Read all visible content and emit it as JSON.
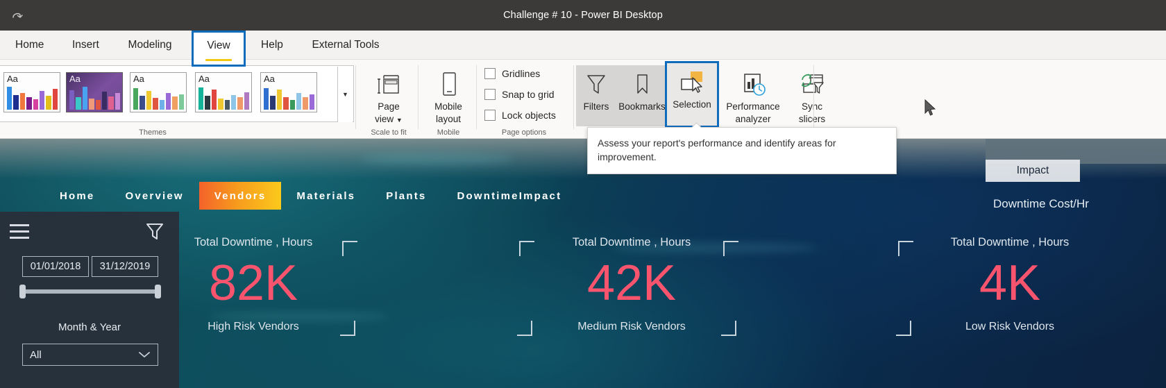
{
  "window": {
    "title": "Challenge # 10 - Power BI Desktop",
    "redo_icon": "redo-icon"
  },
  "ribbon": {
    "tabs": [
      {
        "label": "Home",
        "selected": false
      },
      {
        "label": "Insert",
        "selected": false
      },
      {
        "label": "Modeling",
        "selected": false
      },
      {
        "label": "View",
        "selected": true
      },
      {
        "label": "Help",
        "selected": false
      },
      {
        "label": "External Tools",
        "selected": false
      }
    ],
    "groups": {
      "themes": {
        "label": "Themes"
      },
      "scale_to_fit": {
        "label": "Scale to fit"
      },
      "mobile": {
        "label": "Mobile"
      },
      "page_options": {
        "label": "Page options"
      }
    },
    "themes": {
      "swatch_text": "Aa",
      "more_icon": "chevron-down-icon",
      "swatches": [
        {
          "name": "theme-swatch-0",
          "selected": false,
          "bars": [
            "#c084c0",
            "#8e5aa8"
          ]
        },
        {
          "name": "theme-swatch-1",
          "selected": false,
          "bars": [
            "#2f8de4",
            "#1d2f8f",
            "#f0783c",
            "#7b1e8c",
            "#d6409f",
            "#9a6bd6",
            "#e3c019",
            "#e0453f"
          ]
        },
        {
          "name": "theme-swatch-2",
          "selected": true,
          "bars": [
            "#7b5fc0",
            "#3ac9c9",
            "#4aa3f0",
            "#f09a7a",
            "#e0553f",
            "#3a2b63",
            "#e0608f",
            "#c88ad6"
          ]
        },
        {
          "name": "theme-swatch-3",
          "selected": false,
          "bars": [
            "#4aa85e",
            "#3c4d8c",
            "#f0c830",
            "#e0553f",
            "#6fb0e8",
            "#9a6bd6",
            "#f0a060",
            "#7ec99a"
          ]
        },
        {
          "name": "theme-swatch-4",
          "selected": false,
          "bars": [
            "#14b39a",
            "#2b3a42",
            "#e0453f",
            "#f0c830",
            "#4a5a62",
            "#8fc6e8",
            "#f09a6a",
            "#b07ac0"
          ]
        },
        {
          "name": "theme-swatch-5",
          "selected": false,
          "bars": [
            "#2f6fd0",
            "#2b3a72",
            "#f0c830",
            "#e0553f",
            "#3a9a5e",
            "#8fc6e8",
            "#f09a6a",
            "#9a6bd6"
          ]
        }
      ]
    },
    "buttons": {
      "page_view": {
        "label_line1": "Page",
        "label_line2": "view",
        "icon": "page-view-icon",
        "has_caret": true
      },
      "mobile_layout": {
        "label_line1": "Mobile",
        "label_line2": "layout",
        "icon": "mobile-layout-icon"
      },
      "filters": {
        "label": "Filters",
        "icon": "filter-funnel-icon",
        "highlighted": true
      },
      "bookmarks": {
        "label": "Bookmarks",
        "icon": "bookmark-icon",
        "highlighted": true
      },
      "selection": {
        "label": "Selection",
        "icon": "selection-pane-icon",
        "selected": true
      },
      "performance": {
        "label_line1": "Performance",
        "label_line2": "analyzer",
        "icon": "performance-analyzer-icon"
      },
      "sync_slicers": {
        "label_line1": "Sync",
        "label_line2": "slicers",
        "icon": "sync-slicers-icon"
      }
    },
    "checkboxes": [
      {
        "label": "Gridlines",
        "checked": false
      },
      {
        "label": "Snap to grid",
        "checked": false
      },
      {
        "label": "Lock objects",
        "checked": false
      }
    ],
    "tooltip": {
      "text": "Assess your report's performance and identify areas for improvement."
    }
  },
  "report": {
    "nav": [
      {
        "label": "Home",
        "active": false
      },
      {
        "label": "Overview",
        "active": false
      },
      {
        "label": "Vendors",
        "active": true
      },
      {
        "label": "Materials",
        "active": false
      },
      {
        "label": "Plants",
        "active": false
      },
      {
        "label": "DowntimeImpact",
        "active": false
      }
    ],
    "slicer": {
      "menu_icon": "hamburger-menu-icon",
      "filter_icon": "filter-funnel-icon",
      "date_start": "01/01/2018",
      "date_end": "31/12/2019",
      "label": "Month & Year",
      "dropdown_value": "All",
      "dropdown_caret": "chevron-down-icon"
    },
    "kpis": [
      {
        "title": "Total Downtime , Hours",
        "value": "82K",
        "subtitle": "High Risk Vendors"
      },
      {
        "title": "Total Downtime , Hours",
        "value": "42K",
        "subtitle": "Medium Risk Vendors"
      },
      {
        "title": "Total Downtime , Hours",
        "value": "4K",
        "subtitle": "Low Risk Vendors"
      }
    ],
    "impact_button": "Impact",
    "cost_label": "Downtime Cost/Hr"
  },
  "colors": {
    "accent_blue": "#0f6cbd",
    "tab_underline": "#f2c811",
    "kpi_value": "#f9546e",
    "nav_active_from": "#f4622a",
    "nav_active_to": "#fbc91b",
    "titlebar": "#3b3a39"
  }
}
